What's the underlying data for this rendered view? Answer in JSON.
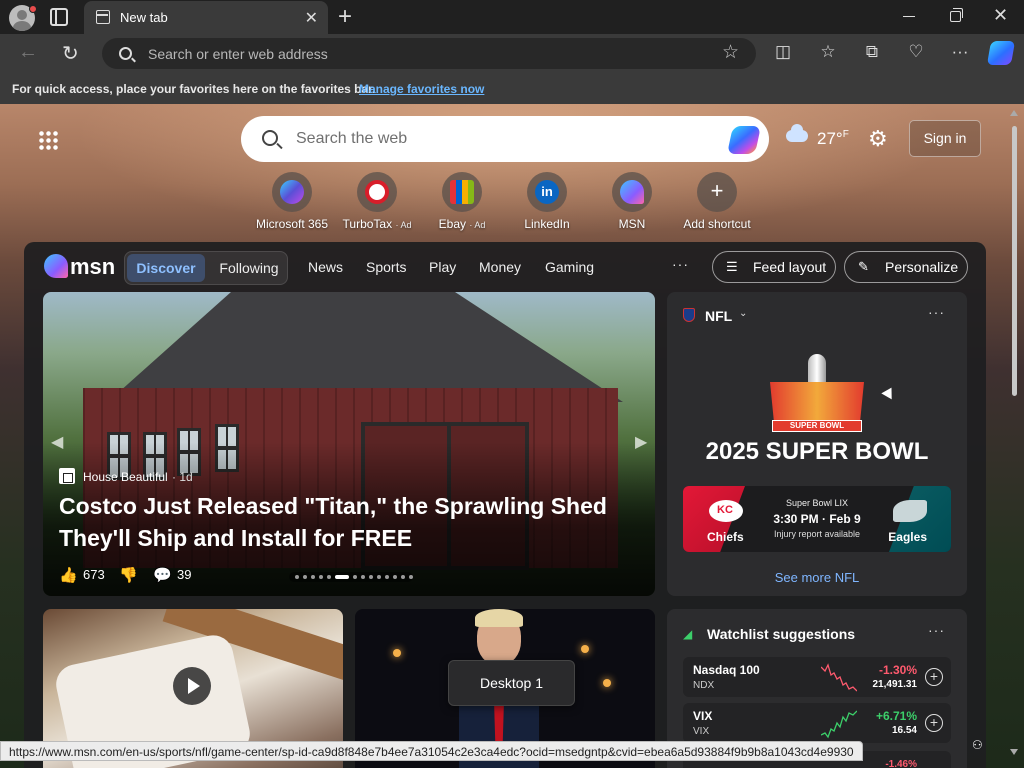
{
  "browser": {
    "tab_title": "New tab",
    "tab_close": "✕",
    "new_tab": "+",
    "address_placeholder": "Search or enter web address",
    "window_close": "✕"
  },
  "favorites_bar": {
    "text": "For quick access, place your favorites here on the favorites bar.",
    "link": "Manage favorites now"
  },
  "newtab": {
    "search_placeholder": "Search the web",
    "weather_temp": "27°",
    "weather_unit": "F",
    "sign_in": "Sign in",
    "shortcuts": [
      {
        "label": "Microsoft 365",
        "ad": "",
        "color": "#5a4fd6"
      },
      {
        "label": "TurboTax",
        "ad": "· Ad",
        "color": "#d81e2a"
      },
      {
        "label": "Ebay",
        "ad": "· Ad",
        "color": "#2a2a2a"
      },
      {
        "label": "LinkedIn",
        "ad": "",
        "color": "#0a66c2"
      },
      {
        "label": "MSN",
        "ad": "",
        "color": "#7a55ff"
      },
      {
        "label": "Add shortcut",
        "ad": "",
        "color": "transparent"
      }
    ]
  },
  "feed": {
    "logo_text": "msn",
    "discover": "Discover",
    "following": "Following",
    "nav": [
      "News",
      "Sports",
      "Play",
      "Money",
      "Gaming"
    ],
    "more": "···",
    "feed_layout": "Feed layout",
    "personalize": "Personalize"
  },
  "hero": {
    "source": "House Beautiful",
    "age": "· 1d",
    "title": "Costco Just Released \"Titan,\" the Sprawling Shed They'll Ship and Install for FREE",
    "likes": "673",
    "comments": "39",
    "slide_count": 14,
    "active_slide": 5
  },
  "nfl": {
    "league": "NFL",
    "more": "···",
    "banner": "SUPER BOWL",
    "headline": "2025 SUPER BOWL",
    "event": "Super Bowl LIX",
    "time": "3:30 PM · Feb 9",
    "injury": "Injury report available",
    "team_home": "Chiefs",
    "team_away": "Eagles",
    "see_more": "See more NFL"
  },
  "overlay": {
    "desktop": "Desktop 1"
  },
  "watchlist": {
    "title": "Watchlist suggestions",
    "more": "···",
    "stocks": [
      {
        "name": "Nasdaq 100",
        "ticker": "NDX",
        "change": "-1.30%",
        "price": "21,491.31",
        "color": "#ff5a6e"
      },
      {
        "name": "VIX",
        "ticker": "VIX",
        "change": "+6.71%",
        "price": "16.54",
        "color": "#3ccf6a"
      }
    ],
    "peek_change": "-1.46%"
  },
  "status_url": "https://www.msn.com/en-us/sports/nfl/game-center/sp-id-ca9d8f848e7b4ee7a31054c2e3ca4edc?ocid=msedgntp&cvid=ebea6a5d93884f9b9b8a1043cd4e9930"
}
